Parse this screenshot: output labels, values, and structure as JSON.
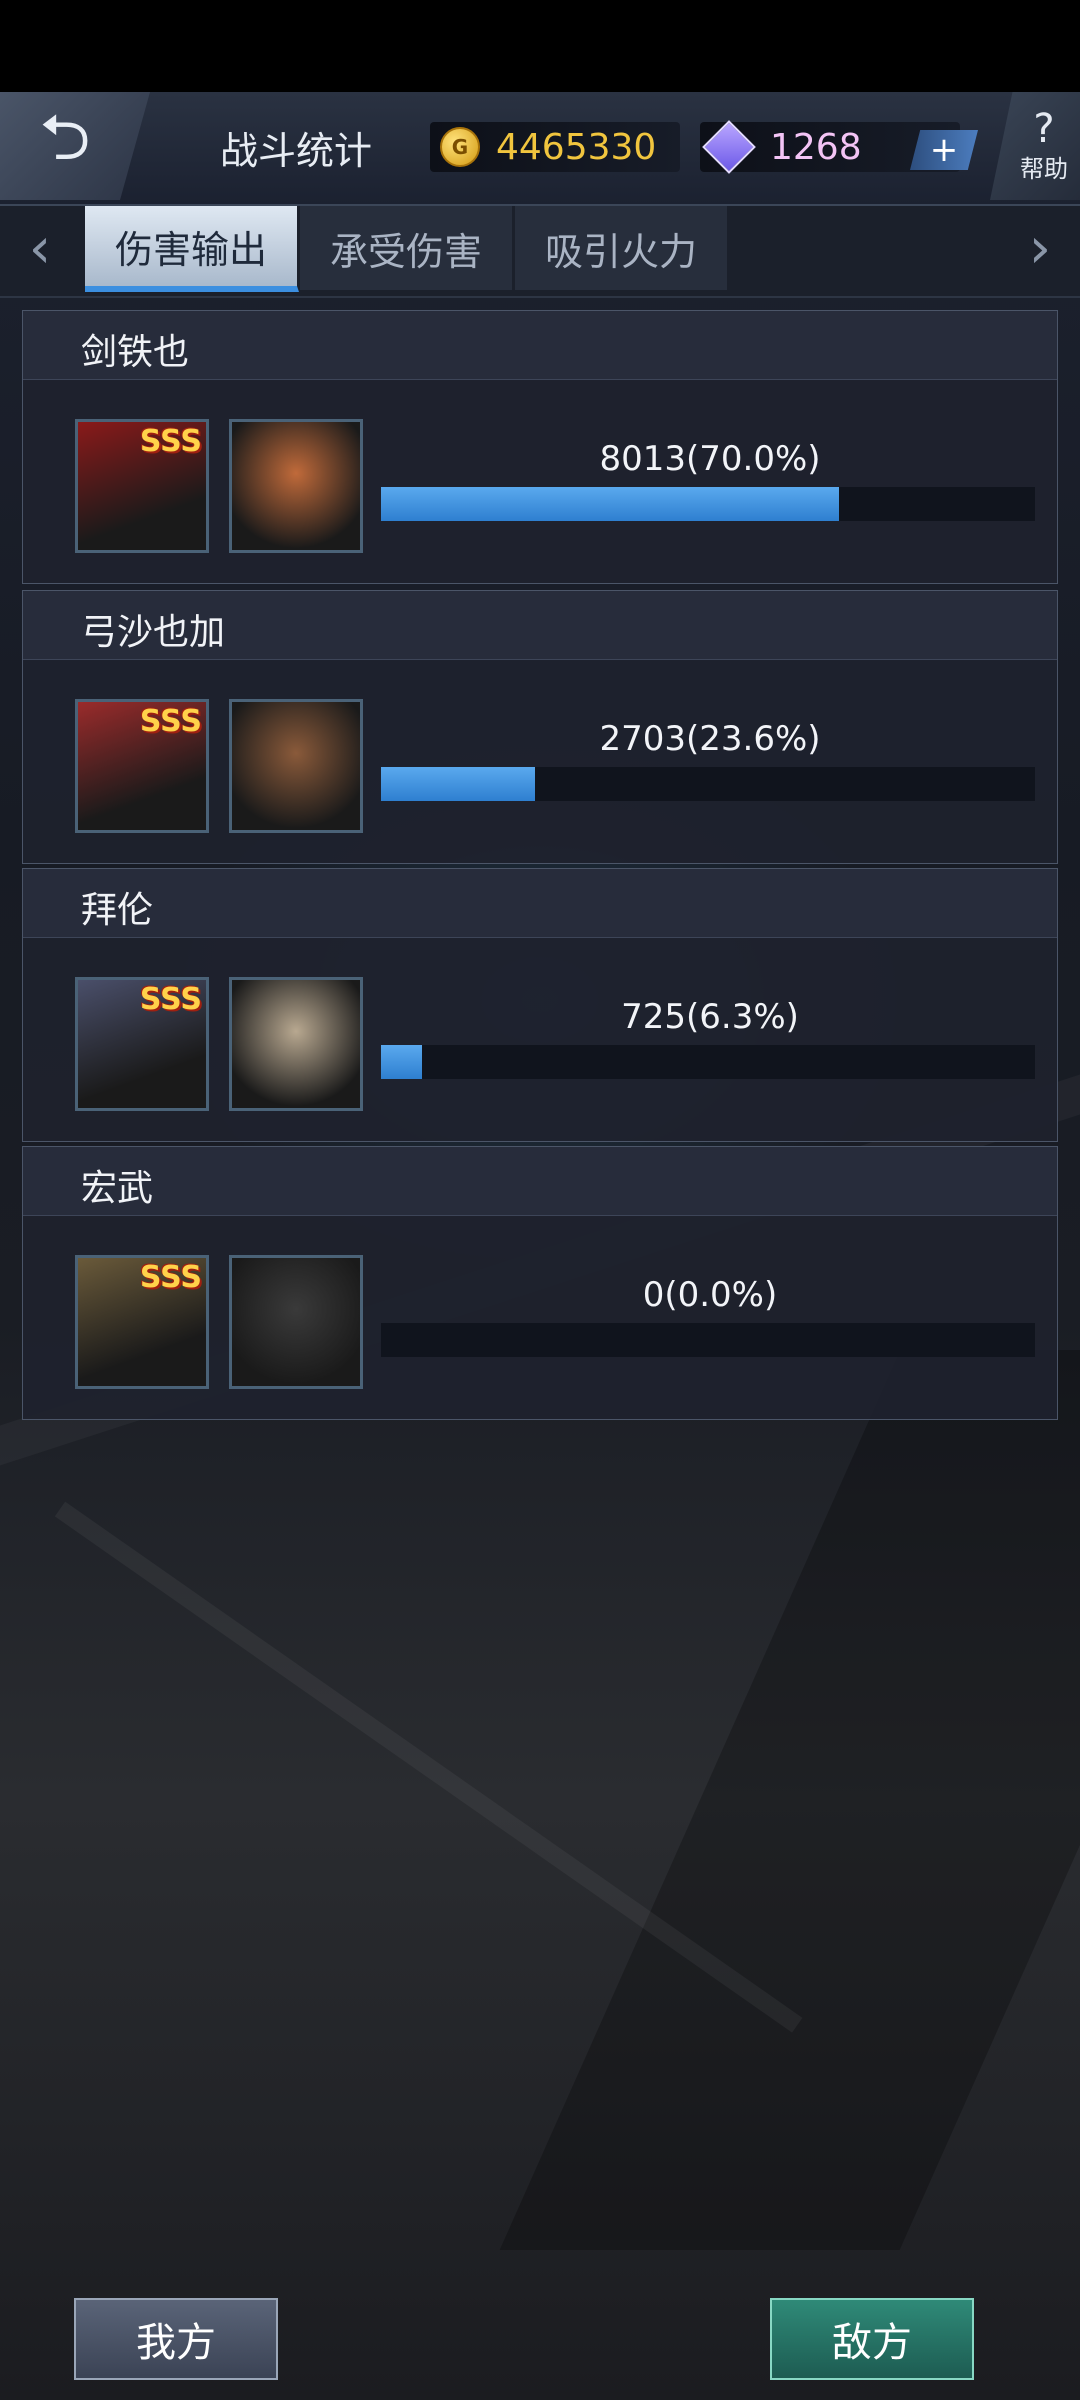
{
  "header": {
    "title": "战斗统计",
    "gold": "4465330",
    "gems": "1268",
    "plus_label": "+",
    "help_label": "帮助"
  },
  "tabs": [
    {
      "label": "伤害输出",
      "active": true
    },
    {
      "label": "承受伤害",
      "active": false
    },
    {
      "label": "吸引火力",
      "active": false
    }
  ],
  "players": [
    {
      "name": "剑铁也",
      "rank": "SSS",
      "stat": "8013(70.0%)",
      "percent": 70.0,
      "mech_color": "#8a1a1a",
      "pilot_color": "#c06a3a"
    },
    {
      "name": "弓沙也加",
      "rank": "SSS",
      "stat": "2703(23.6%)",
      "percent": 23.6,
      "mech_color": "#9a2b2b",
      "pilot_color": "#8a5a3a"
    },
    {
      "name": "拜伦",
      "rank": "SSS",
      "stat": "725(6.3%)",
      "percent": 6.3,
      "mech_color": "#4a4f6a",
      "pilot_color": "#b8a890"
    },
    {
      "name": "宏武",
      "rank": "SSS",
      "stat": "0(0.0%)",
      "percent": 0.0,
      "mech_color": "#6a5a3a",
      "pilot_color": "#3a3a3a"
    }
  ],
  "footer": {
    "ally_label": "我方",
    "enemy_label": "敌方"
  },
  "colors": {
    "bar_fill": "#3c8fe0",
    "gold_text": "#f1c53e",
    "gem_text": "#f3c4f5"
  }
}
